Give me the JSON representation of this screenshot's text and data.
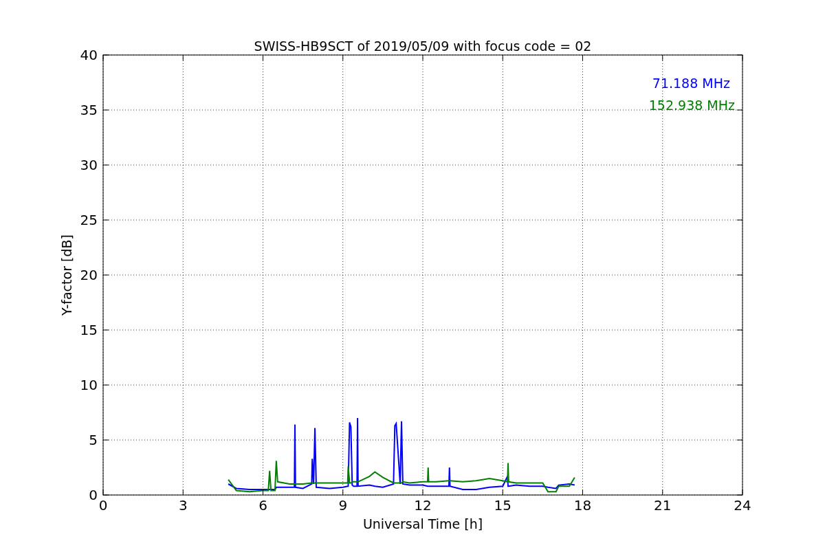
{
  "figure": {
    "chart_data": {
      "type": "line",
      "title": "SWISS-HB9SCT of 2019/05/09 with focus code = 02",
      "xlabel": "Universal Time [h]",
      "ylabel": "Y-factor [dB]",
      "xlim": [
        0,
        24
      ],
      "ylim": [
        0,
        40
      ],
      "xticks": [
        0,
        3,
        6,
        9,
        12,
        15,
        18,
        21,
        24
      ],
      "yticks": [
        0,
        5,
        10,
        15,
        20,
        25,
        30,
        35,
        40
      ],
      "grid": true,
      "x": [
        4.7,
        5.0,
        5.5,
        6.0,
        6.2,
        6.25,
        6.3,
        6.45,
        6.5,
        6.55,
        7.0,
        7.18,
        7.2,
        7.22,
        7.5,
        7.83,
        7.85,
        7.9,
        7.95,
        8.0,
        8.5,
        9.0,
        9.18,
        9.2,
        9.25,
        9.3,
        9.35,
        9.4,
        9.53,
        9.55,
        9.57,
        10.0,
        10.2,
        10.5,
        10.9,
        10.95,
        11.0,
        11.15,
        11.2,
        11.25,
        11.5,
        12.0,
        12.18,
        12.2,
        12.22,
        12.5,
        12.98,
        13.0,
        13.02,
        13.5,
        14.0,
        14.5,
        15.0,
        15.18,
        15.2,
        15.22,
        15.5,
        16.0,
        16.5,
        16.7,
        17.0,
        17.1,
        17.5,
        17.7
      ],
      "series": [
        {
          "name": "71.188 MHz",
          "color": "#0000ff",
          "values": [
            1.0,
            0.6,
            0.5,
            0.5,
            0.5,
            0.5,
            0.5,
            0.5,
            0.7,
            0.7,
            0.7,
            0.7,
            6.4,
            0.7,
            0.6,
            1.0,
            3.3,
            1.0,
            6.1,
            0.7,
            0.6,
            0.7,
            0.8,
            0.8,
            6.6,
            6.2,
            0.9,
            0.8,
            0.8,
            7.0,
            0.8,
            0.9,
            0.8,
            0.7,
            1.0,
            6.3,
            6.5,
            1.0,
            6.7,
            1.0,
            0.9,
            0.9,
            0.8,
            0.8,
            0.8,
            0.8,
            0.8,
            2.5,
            0.8,
            0.5,
            0.5,
            0.7,
            0.8,
            1.7,
            0.8,
            0.8,
            0.9,
            0.8,
            0.8,
            0.7,
            0.6,
            0.9,
            1.0,
            0.9
          ]
        },
        {
          "name": "152.938 MHz",
          "color": "#008000",
          "values": [
            1.4,
            0.4,
            0.3,
            0.4,
            0.4,
            2.2,
            0.4,
            0.4,
            3.1,
            1.2,
            1.0,
            1.0,
            1.0,
            1.0,
            1.0,
            1.1,
            1.1,
            1.1,
            1.1,
            1.1,
            1.1,
            1.1,
            1.1,
            2.6,
            1.1,
            1.1,
            1.2,
            1.2,
            1.2,
            1.2,
            1.2,
            1.7,
            2.1,
            1.6,
            1.1,
            1.1,
            1.1,
            1.1,
            1.1,
            1.2,
            1.1,
            1.2,
            1.2,
            2.5,
            1.2,
            1.2,
            1.3,
            1.3,
            1.3,
            1.2,
            1.3,
            1.5,
            1.3,
            1.2,
            2.9,
            1.2,
            1.1,
            1.1,
            1.1,
            0.3,
            0.3,
            0.8,
            0.8,
            1.6
          ]
        }
      ]
    }
  }
}
